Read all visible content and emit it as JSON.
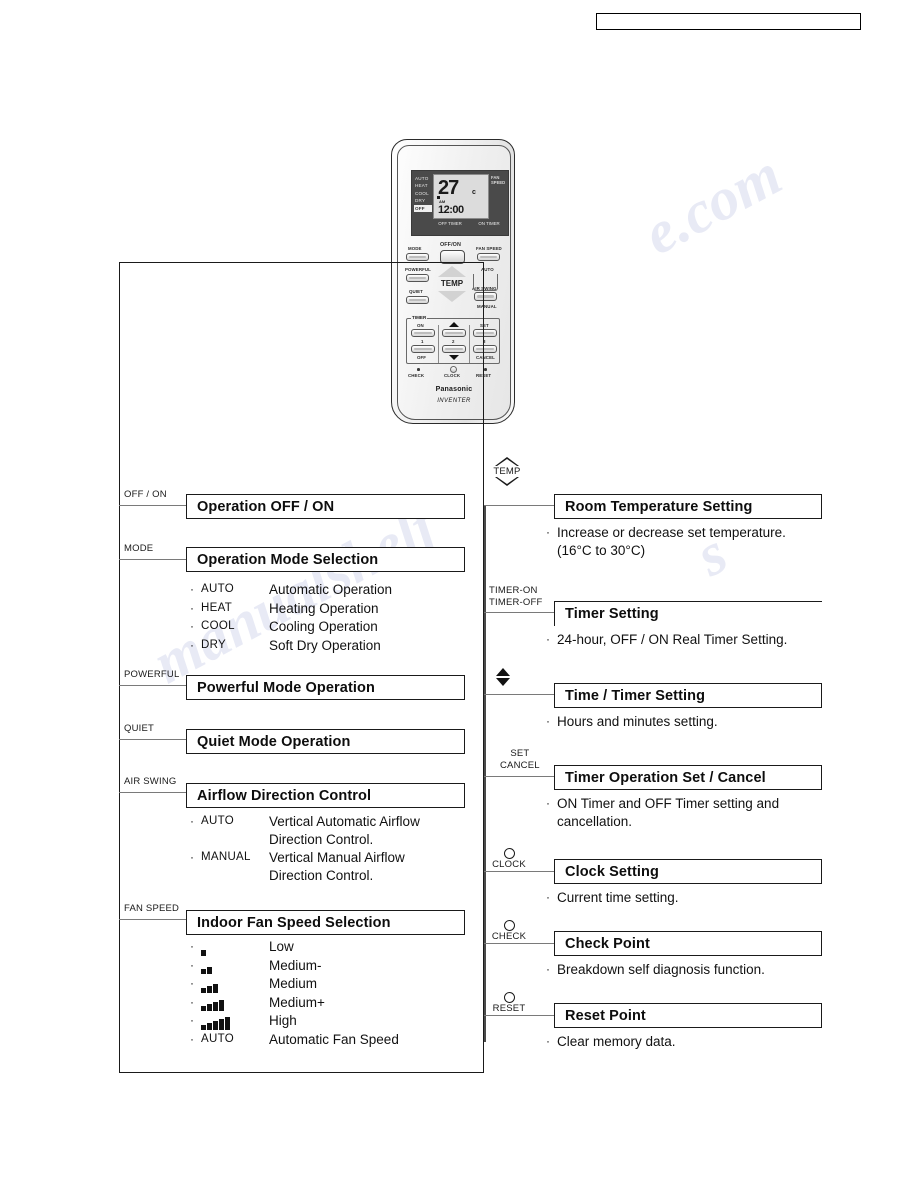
{
  "header": {
    "box_label": ""
  },
  "remote": {
    "lcd": {
      "modes": [
        "AUTO",
        "HEAT",
        "COOL",
        "DRY",
        "OFF"
      ],
      "selected_mode": "OFF",
      "temperature": "27",
      "unit": "c",
      "meridiem": "AM",
      "clock": "12:00",
      "auto_label": "AUTO",
      "fan_speed_label": "FAN SPEED",
      "off_timer": "OFF TIMER",
      "on_timer": "ON TIMER"
    },
    "buttons": {
      "mode": "MODE",
      "off_on": "OFF/ON",
      "fan_speed": "FAN SPEED",
      "powerful": "POWERFUL",
      "quiet": "QUIET",
      "auto": "AUTO",
      "air_swing": "AIR SWING",
      "manual": "MANUAL",
      "temp": "TEMP",
      "timer_legend": "TIMER",
      "timer_on": "ON",
      "timer_off": "OFF",
      "set": "SET",
      "cancel": "CANCEL",
      "num1": "1",
      "num2": "2",
      "num3": "3",
      "check": "CHECK",
      "clock": "CLOCK",
      "reset": "RESET"
    },
    "brand": "Panasonic",
    "brand_sub": "INVENTER"
  },
  "left_column": [
    {
      "side_label": "OFF / ON",
      "title": "Operation OFF / ON",
      "items": []
    },
    {
      "side_label": "MODE",
      "title": "Operation Mode Selection",
      "items": [
        {
          "key": "AUTO",
          "value": "Automatic Operation"
        },
        {
          "key": "HEAT",
          "value": "Heating Operation"
        },
        {
          "key": "COOL",
          "value": "Cooling Operation"
        },
        {
          "key": "DRY",
          "value": "Soft Dry Operation"
        }
      ]
    },
    {
      "side_label": "POWERFUL",
      "title": "Powerful Mode Operation",
      "items": []
    },
    {
      "side_label": "QUIET",
      "title": "Quiet Mode Operation",
      "items": []
    },
    {
      "side_label": "AIR SWING",
      "title": "Airflow Direction Control",
      "items": [
        {
          "key": "AUTO",
          "value": "Vertical Automatic Airflow",
          "value2": "Direction Control."
        },
        {
          "key": "MANUAL",
          "value": "Vertical Manual Airflow",
          "value2": "Direction Control."
        }
      ]
    },
    {
      "side_label": "FAN SPEED",
      "title": "Indoor Fan Speed Selection",
      "items": [
        {
          "bars": 1,
          "value": "Low"
        },
        {
          "bars": 2,
          "value": "Medium-"
        },
        {
          "bars": 3,
          "value": "Medium"
        },
        {
          "bars": 4,
          "value": "Medium+"
        },
        {
          "bars": 5,
          "value": "High"
        },
        {
          "key": "AUTO",
          "value": "Automatic Fan Speed"
        }
      ]
    }
  ],
  "right_column": [
    {
      "icon": "temp-up-down-icon",
      "icon_caption": "TEMP",
      "title": "Room Temperature Setting",
      "lines": [
        "Increase or decrease set temperature.",
        "(16°C to 30°C)"
      ]
    },
    {
      "icon": "timer-on-off-icon",
      "icon_caption": "TIMER-ON\nTIMER-OFF",
      "caption_line1": "TIMER-ON",
      "caption_line2": "TIMER-OFF",
      "title": "Timer Setting",
      "lines": [
        "24-hour, OFF / ON Real Timer Setting."
      ]
    },
    {
      "icon": "up-down-arrows-icon",
      "icon_caption": "",
      "title": "Time / Timer Setting",
      "lines": [
        "Hours and minutes setting."
      ]
    },
    {
      "icon": "set-cancel-icon",
      "caption_line1": "SET",
      "caption_line2": "CANCEL",
      "title": "Timer Operation Set / Cancel",
      "lines": [
        "ON Timer and OFF Timer setting and",
        "cancellation."
      ]
    },
    {
      "icon": "clock-button-icon",
      "icon_caption": "CLOCK",
      "title": "Clock Setting",
      "lines": [
        "Current time setting."
      ]
    },
    {
      "icon": "check-button-icon",
      "icon_caption": "CHECK",
      "title": "Check Point",
      "lines": [
        "Breakdown self diagnosis function."
      ]
    },
    {
      "icon": "reset-button-icon",
      "icon_caption": "RESET",
      "title": "Reset Point",
      "lines": [
        "Clear memory data."
      ]
    }
  ],
  "colors": {
    "ink": "#1a1a1a",
    "connector": "#7a7a7a",
    "shadow": "#c0c0c0"
  }
}
